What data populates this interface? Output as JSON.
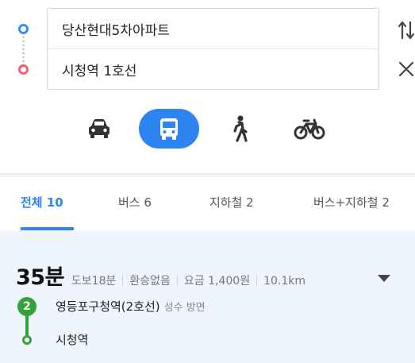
{
  "route": {
    "origin": "당산현대5차아파트",
    "destination": "시청역 1호선"
  },
  "icons": {
    "swap": "swap-arrows-icon",
    "close": "close-icon",
    "car": "car-icon",
    "bus": "bus-icon",
    "walk": "walk-icon",
    "bike": "bicycle-icon",
    "expand": "caret-down-icon"
  },
  "modes": {
    "selected": "bus"
  },
  "tabs": [
    {
      "label": "전체 10",
      "active": true
    },
    {
      "label": "버스 6",
      "active": false
    },
    {
      "label": "지하철 2",
      "active": false
    },
    {
      "label": "버스+지하철 2",
      "active": false
    }
  ],
  "result": {
    "duration": "35분",
    "walk": "도보18분",
    "transfer": "환승없음",
    "fare": "요금 1,400원",
    "distance": "10.1km",
    "line_number": "2",
    "board_station": "영등포구청역(2호선)",
    "direction": "성수 방면",
    "arrive_station": "시청역"
  },
  "colors": {
    "accent": "#2e84f0",
    "line2": "#33a23d",
    "origin_marker": "#3d8cf0",
    "destination_marker": "#f0626b",
    "result_bg": "#eef5fc"
  }
}
